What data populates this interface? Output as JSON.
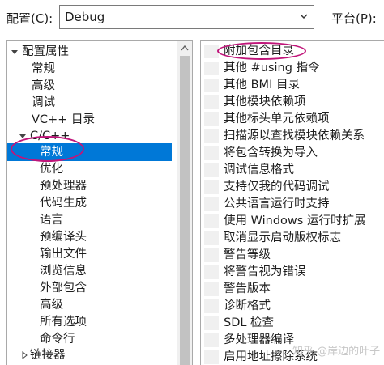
{
  "header": {
    "config_label": "配置(C):",
    "config_value": "Debug",
    "platform_label": "平台(P):"
  },
  "tree": {
    "root": "配置属性",
    "items": [
      "常规",
      "高级",
      "调试",
      "VC++ 目录"
    ],
    "cpp_group": "C/C++",
    "cpp_items": [
      "常规",
      "优化",
      "预处理器",
      "代码生成",
      "语言",
      "预编译头",
      "输出文件",
      "浏览信息",
      "外部包含",
      "高级",
      "所有选项",
      "命令行"
    ],
    "linker": "链接器",
    "selected": "常规"
  },
  "properties": [
    "附加包含目录",
    "其他 #using 指令",
    "其他 BMI 目录",
    "其他模块依赖项",
    "其他标头单元依赖项",
    "扫描源以查找模块依赖关系",
    "将包含转换为导入",
    "调试信息格式",
    "支持仅我的代码调试",
    "公共语言运行时支持",
    "使用 Windows 运行时扩展",
    "取消显示启动版权标志",
    "警告等级",
    "将警告视为错误",
    "警告版本",
    "诊断格式",
    "SDL 检查",
    "多处理器编译",
    "启用地址擦除系统"
  ],
  "watermark": "知乎 @岸边的叶子",
  "colors": {
    "selection": "#0078d7",
    "highlight_oval": "#c0157a"
  }
}
